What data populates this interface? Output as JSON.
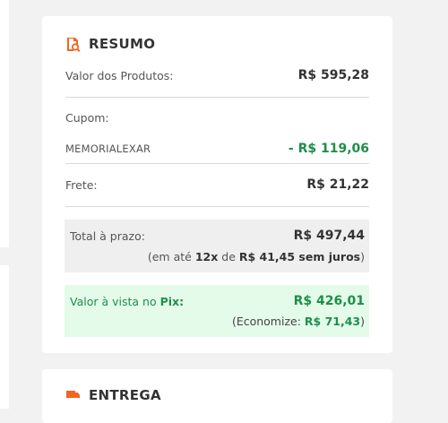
{
  "summary": {
    "title": "RESUMO",
    "icon": "receipt-search-icon",
    "products_label": "Valor dos Produtos:",
    "products_value": "R$ 595,28",
    "coupon_label": "Cupom:",
    "coupon_code": "MEMORIALEXAR",
    "coupon_discount": "- R$ 119,06",
    "shipping_label": "Frete:",
    "shipping_value": "R$ 21,22",
    "total": {
      "label": "Total à prazo:",
      "value": "R$ 497,44",
      "installments_prefix": "(em até ",
      "installments_count": "12x",
      "installments_mid": " de ",
      "installments_amount": "R$ 41,45",
      "installments_suffix": " sem juros",
      "installments_close": ")"
    },
    "pix": {
      "label_prefix": "Valor à vista no ",
      "label_strong": "Pix:",
      "value": "R$ 426,01",
      "savings_prefix": "(Economize: ",
      "savings_amount": "R$ 71,43",
      "savings_close": ")"
    }
  },
  "delivery": {
    "title": "ENTREGA",
    "icon": "truck-icon"
  },
  "colors": {
    "accent": "#f26522",
    "green": "#1e8e4a",
    "pix_bg": "#e4fbea",
    "total_bg": "#efefef"
  }
}
